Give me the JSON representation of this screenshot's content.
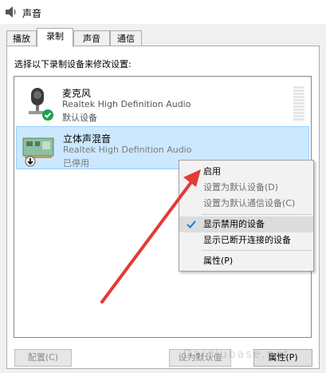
{
  "window": {
    "title": "声音"
  },
  "tabs": [
    {
      "label": "播放"
    },
    {
      "label": "录制"
    },
    {
      "label": "声音"
    },
    {
      "label": "通信"
    }
  ],
  "instruction": "选择以下录制设备来修改设置:",
  "devices": [
    {
      "name": "麦克风",
      "description": "Realtek High Definition Audio",
      "status": "默认设备"
    },
    {
      "name": "立体声混音",
      "description": "Realtek High Definition Audio",
      "status": "已停用"
    }
  ],
  "context_menu": {
    "items": [
      {
        "label": "启用"
      },
      {
        "label": "设置为默认设备(D)"
      },
      {
        "label": "设置为默认通信设备(C)"
      },
      {
        "label": "显示禁用的设备"
      },
      {
        "label": "显示已断开连接的设备"
      },
      {
        "label": "属性(P)"
      }
    ]
  },
  "buttons": {
    "configure": "配置(C)",
    "set_default": "设为默认值",
    "properties": "属性(P)"
  },
  "watermark": "Daidiubase.net",
  "colors": {
    "selection": "#cce8ff",
    "check_accent": "#0078d7",
    "status_green": "#1aa34a",
    "annotation_arrow": "#e53935"
  }
}
